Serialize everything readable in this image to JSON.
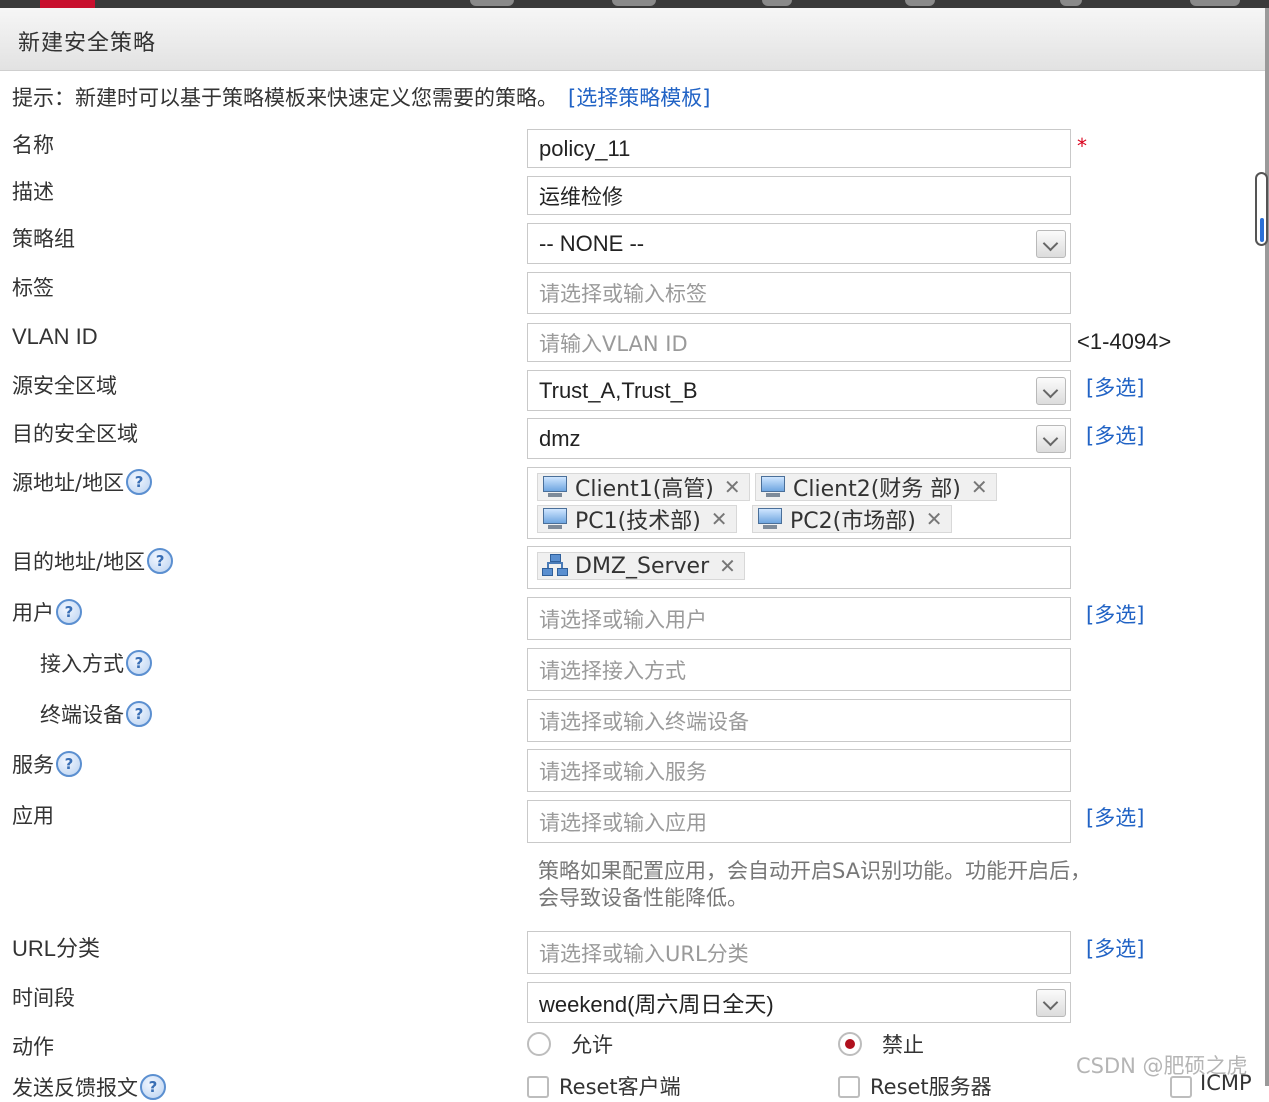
{
  "dialog": {
    "title": "新建安全策略"
  },
  "hint": {
    "text": "提示：新建时可以基于策略模板来快速定义您需要的策略。",
    "link": "[选择策略模板]"
  },
  "labels": {
    "name": "名称",
    "description": "描述",
    "policy_group": "策略组",
    "tag": "标签",
    "vlan": "VLAN ID",
    "src_zone": "源安全区域",
    "dst_zone": "目的安全区域",
    "src_addr": "源地址/地区",
    "dst_addr": "目的地址/地区",
    "user": "用户",
    "access_mode": "接入方式",
    "terminal": "终端设备",
    "service": "服务",
    "application": "应用",
    "url": "URL分类",
    "time_range": "时间段",
    "action": "动作",
    "feedback": "发送反馈报文"
  },
  "values": {
    "name": "policy_11",
    "description": "运维检修",
    "policy_group": "-- NONE --",
    "src_zone": "Trust_A,Trust_B",
    "dst_zone": "dmz",
    "time_range": "weekend(周六周日全天)"
  },
  "placeholders": {
    "tag": "请选择或输入标签",
    "vlan": "请输入VLAN ID",
    "user": "请选择或输入用户",
    "access_mode": "请选择接入方式",
    "terminal": "请选择或输入终端设备",
    "service": "请选择或输入服务",
    "application": "请选择或输入应用",
    "url": "请选择或输入URL分类"
  },
  "vlan_range": "<1-4094>",
  "required_mark": "*",
  "multi_select": "[多选]",
  "help_mark": "?",
  "src_addr_tags": [
    "Client1(高管)",
    "Client2(财务 部)",
    "PC1(技术部)",
    "PC2(市场部)"
  ],
  "dst_addr_tags": [
    "DMZ_Server"
  ],
  "remove_mark": "✕",
  "app_note": "策略如果配置应用，会自动开启SA识别功能。功能开启后，会导致设备性能降低。",
  "action": {
    "allow": "允许",
    "deny": "禁止",
    "selected": "deny"
  },
  "feedback_options": [
    "Reset客户端",
    "Reset服务器",
    "ICMP"
  ],
  "watermark": "CSDN @肥硕之虎",
  "colors": {
    "link": "#2163c5",
    "required": "#d9001b",
    "radio_selected": "#b0101e"
  }
}
